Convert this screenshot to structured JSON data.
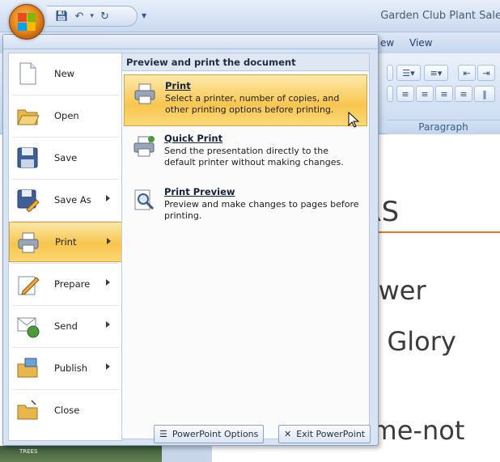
{
  "window": {
    "title": "Garden Club Plant Sale"
  },
  "ribbon": {
    "tabs": [
      "ew",
      "View"
    ],
    "group_label": "Paragraph"
  },
  "slide": {
    "lines": [
      "RS",
      "ower",
      "g Glory",
      "-me-not"
    ],
    "thumb_label": "TREES"
  },
  "menu": {
    "left_items": [
      {
        "label": "New",
        "icon": "new-document-icon",
        "has_submenu": false
      },
      {
        "label": "Open",
        "icon": "open-folder-icon",
        "has_submenu": false
      },
      {
        "label": "Save",
        "icon": "save-disk-icon",
        "has_submenu": false
      },
      {
        "label": "Save As",
        "icon": "save-as-icon",
        "has_submenu": true
      },
      {
        "label": "Print",
        "icon": "printer-icon",
        "has_submenu": true,
        "active": true
      },
      {
        "label": "Prepare",
        "icon": "prepare-pencil-icon",
        "has_submenu": true
      },
      {
        "label": "Send",
        "icon": "send-icon",
        "has_submenu": true
      },
      {
        "label": "Publish",
        "icon": "publish-icon",
        "has_submenu": true
      },
      {
        "label": "Close",
        "icon": "close-folder-icon",
        "has_submenu": false
      }
    ],
    "submenu": {
      "heading": "Preview and print the document",
      "items": [
        {
          "title": "Print",
          "description": "Select a printer, number of copies, and other printing options before printing.",
          "icon": "printer-icon",
          "active": true
        },
        {
          "title": "Quick Print",
          "description": "Send the presentation directly to the default printer without making changes.",
          "icon": "quick-print-icon"
        },
        {
          "title": "Print Preview",
          "description": "Preview and make changes to pages before printing.",
          "icon": "print-preview-icon"
        }
      ]
    },
    "footer": {
      "options_label": "PowerPoint Options",
      "exit_label": "Exit PowerPoint"
    }
  },
  "colors": {
    "highlight": "#f8c64f",
    "accent_line": "#e07b2a",
    "ribbon": "#c8d9f0"
  }
}
